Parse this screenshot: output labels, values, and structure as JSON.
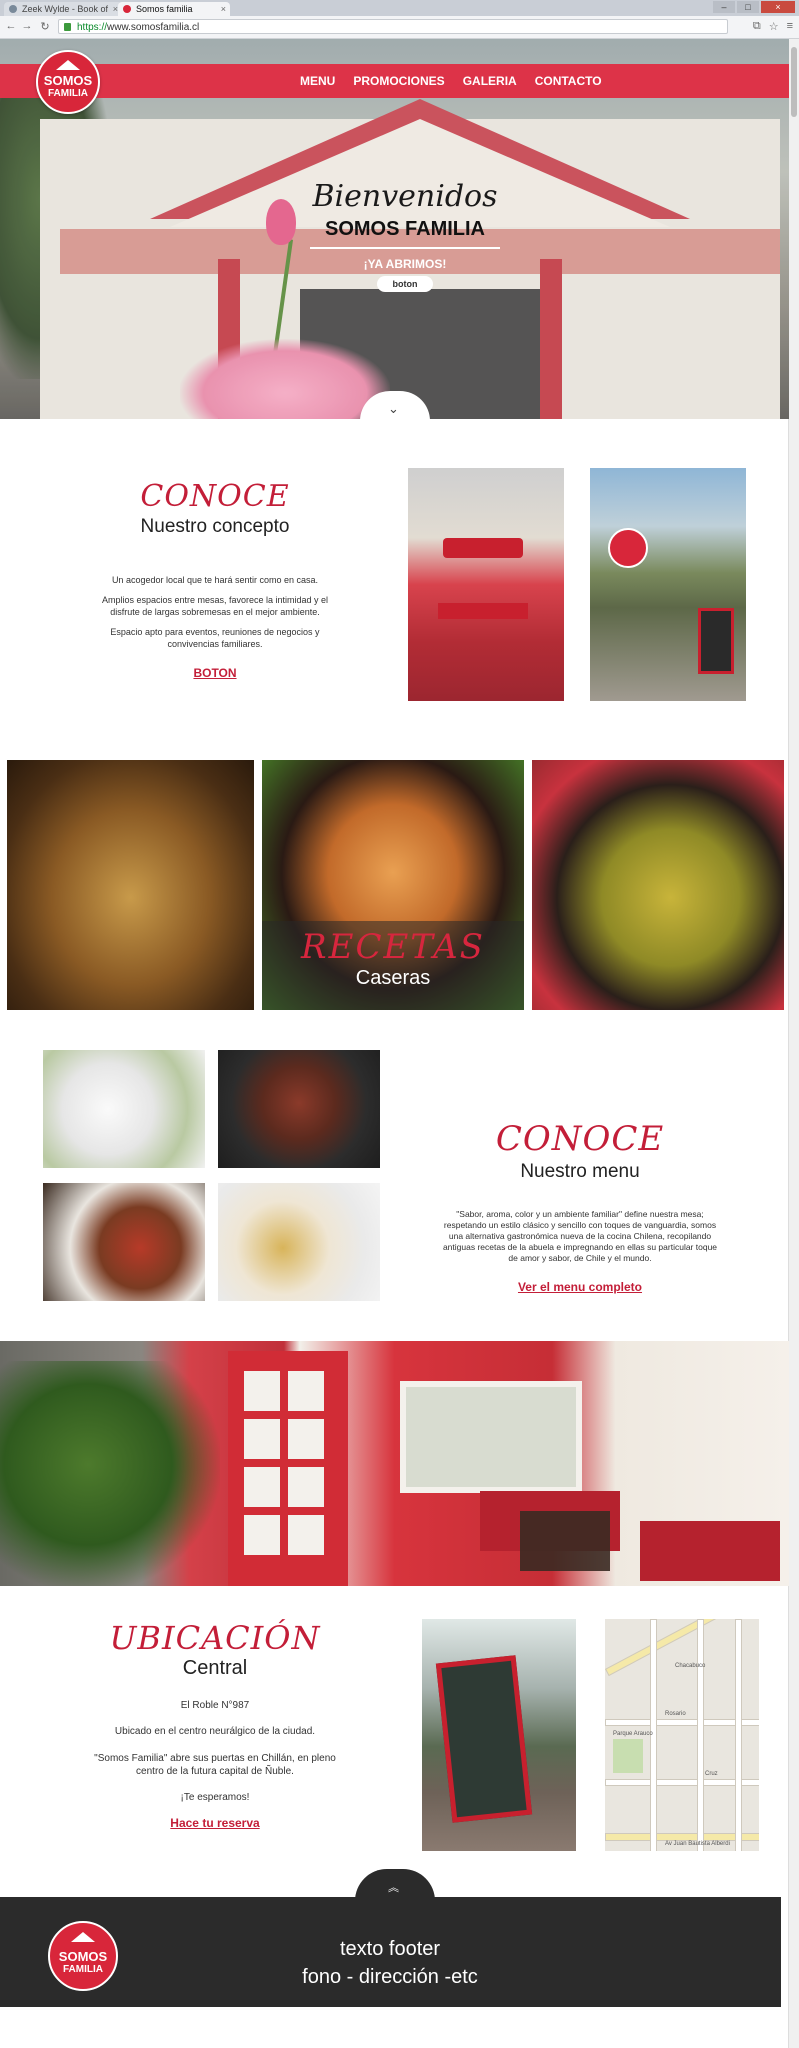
{
  "browser": {
    "tabs": [
      {
        "label": "Zeek Wylde - Book of"
      },
      {
        "label": "Somos familia"
      }
    ],
    "url_scheme": "https://",
    "url_host": "www.somosfamilia.cl"
  },
  "brand": {
    "logo_line1": "SOMOS",
    "logo_line2": "FAMILIA",
    "accent": "#dd3348"
  },
  "nav": {
    "items": [
      "MENU",
      "PROMOCIONES",
      "GALERIA",
      "CONTACTO"
    ]
  },
  "hero": {
    "script_title": "Bienvenidos",
    "subtitle": "SOMOS FAMILIA",
    "tagline": "¡YA ABRIMOS!",
    "button": "boton"
  },
  "concept": {
    "title": "CONOCE",
    "subtitle": "Nuestro concepto",
    "p1": "Un acogedor local que te hará sentir como en casa.",
    "p2": "Amplios espacios entre mesas, favorece la intimidad y el disfrute de largas sobremesas en el mejor ambiente.",
    "p3": "Espacio apto para eventos, reuniones de negocios y convivencias familiares.",
    "link": "BOTON"
  },
  "recipes": {
    "title": "RECETAS",
    "subtitle": "Caseras"
  },
  "menu_section": {
    "title": "CONOCE",
    "subtitle": "Nuestro menu",
    "body": "\"Sabor, aroma, color y un ambiente familiar\" define nuestra mesa; respetando un estilo clásico y sencillo con toques de vanguardia, somos una alternativa gastronómica nueva de la cocina Chilena, recopilando antiguas recetas de la abuela e impregnando en ellas su particular toque de amor y sabor, de Chile y el mundo.",
    "link": "Ver el menu completo"
  },
  "location": {
    "title": "UBICACIÓN",
    "subtitle": "Central",
    "address": "El Roble N°987",
    "p1": "Ubicado en el centro neurálgico de la ciudad.",
    "p2": "\"Somos Familia\" abre sus puertas en Chillán, en pleno centro de la futura capital de Ñuble.",
    "p3": "¡Te esperamos!",
    "link": "Hace tu reserva",
    "map_labels": [
      "Chacabuco",
      "Parque Arauco",
      "Rosario",
      "Cruz",
      "Av Juan Bautista Alberdi"
    ]
  },
  "footer": {
    "line1": "texto footer",
    "line2": "fono - dirección -etc"
  }
}
